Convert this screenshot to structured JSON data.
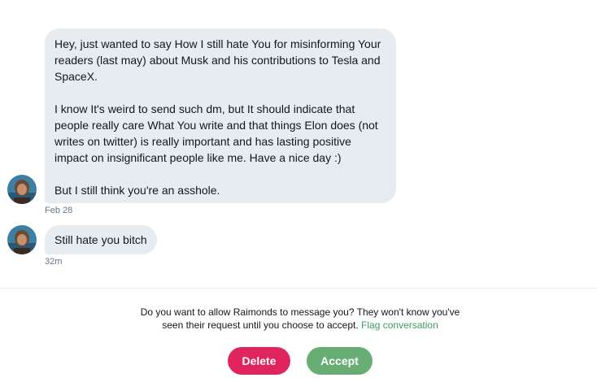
{
  "conversation": {
    "messages": [
      {
        "paragraphs": [
          "Hey, just wanted to say How I still hate You for misinforming Your\nreaders (last may) about Musk and his contributions to Tesla and\nSpaceX.",
          "I know It's weird to send such dm, but It should indicate that\npeople really care What You write and that things Elon does (not\nwrites on twitter) is really important and has lasting positive\nimpact on insignificant people like me. Have a nice day :)",
          "But I still think you're an asshole."
        ],
        "timestamp": "Feb 28"
      },
      {
        "text": "Still hate you bitch",
        "timestamp": "32m"
      }
    ]
  },
  "request": {
    "prompt_line1": "Do you want to allow Raimonds to message you? They won't know you've",
    "prompt_line2": "seen their request until you choose to accept. ",
    "flag_link": "Flag conversation"
  },
  "actions": {
    "delete_label": "Delete",
    "accept_label": "Accept"
  },
  "colors": {
    "bubble_bg": "#e6ecf0",
    "delete": "#e0245e",
    "accept": "#68ad74",
    "link": "#3a9d5d",
    "muted_text": "#657786"
  },
  "icons": {
    "avatar": "user-avatar-photo"
  }
}
